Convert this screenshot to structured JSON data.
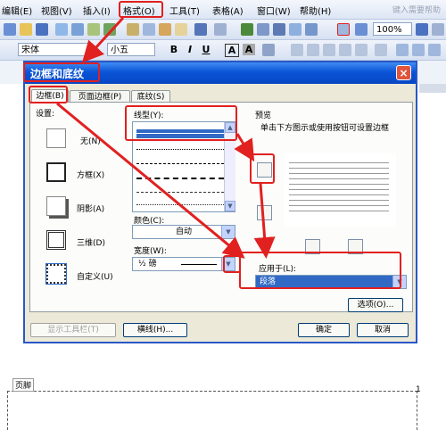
{
  "menubar": {
    "items": [
      "编辑(E)",
      "视图(V)",
      "插入(I)",
      "格式(O)",
      "工具(T)",
      "表格(A)",
      "窗口(W)",
      "帮助(H)"
    ],
    "help_search_placeholder": "键入需要帮助"
  },
  "toolbar": {
    "zoom": "100%",
    "font_name": "宋体",
    "font_size": "小五",
    "bold": "B",
    "italic": "I",
    "underline": "U",
    "char_border": "A",
    "char_shading": "A"
  },
  "dialog": {
    "title": "边框和底纹",
    "close_glyph": "×",
    "tabs": [
      "边框(B)",
      "页面边框(P)",
      "底纹(S)"
    ],
    "settings_label": "设置:",
    "settings": [
      "无(N)",
      "方框(X)",
      "阴影(A)",
      "三维(D)",
      "自定义(U)"
    ],
    "line_style_label": "线型(Y):",
    "color_label": "颜色(C):",
    "color_value": "自动",
    "width_label": "宽度(W):",
    "width_value": "½ 磅",
    "preview_label": "预览",
    "preview_hint": "单击下方图示或使用按钮可设置边框",
    "apply_to_label": "应用于(L):",
    "apply_to_value": "段落",
    "options_button": "选项(O)...",
    "show_toolbar_button": "显示工具栏(T)",
    "horizontal_line_button": "横线(H)...",
    "ok_button": "确定",
    "cancel_button": "取消"
  },
  "document": {
    "footer_label": "页脚",
    "page_number": "1"
  },
  "colors": {
    "annotation": "#e12020",
    "title_bar": "#0a54d6",
    "selected_dropdown": "#316ac5"
  }
}
